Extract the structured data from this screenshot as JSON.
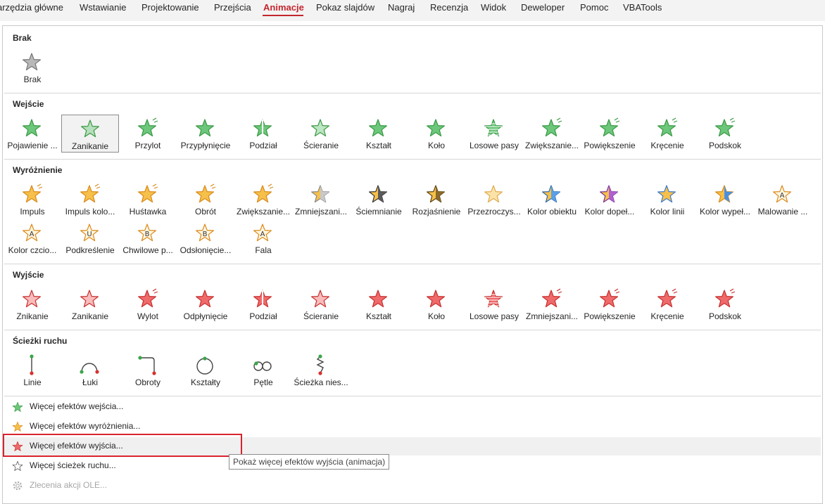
{
  "ribbon": {
    "tabs": [
      "arzędzia główne",
      "Wstawianie",
      "Projektowanie",
      "Przejścia",
      "Animacje",
      "Pokaz slajdów",
      "Nagraj",
      "Recenzja",
      "Widok",
      "Deweloper",
      "Pomoc",
      "VBATools"
    ],
    "active_tab": "Animacje"
  },
  "sections": {
    "none": {
      "title": "Brak",
      "items": [
        {
          "label": "Brak",
          "icon": "star-gray-icon"
        }
      ]
    },
    "entrance": {
      "title": "Wejście",
      "items": [
        {
          "label": "Pojawienie ...",
          "icon": "star-green-icon"
        },
        {
          "label": "Zanikanie",
          "icon": "star-green-fade-icon"
        },
        {
          "label": "Przylot",
          "icon": "star-green-fly-in-icon"
        },
        {
          "label": "Przypłynięcie",
          "icon": "star-green-float-in-icon"
        },
        {
          "label": "Podział",
          "icon": "star-green-split-icon"
        },
        {
          "label": "Ścieranie",
          "icon": "star-green-wipe-icon"
        },
        {
          "label": "Kształt",
          "icon": "star-green-shape-icon"
        },
        {
          "label": "Koło",
          "icon": "star-green-wheel-icon"
        },
        {
          "label": "Losowe pasy",
          "icon": "star-green-random-bars-icon"
        },
        {
          "label": "Zwiększanie...",
          "icon": "star-green-grow-turn-icon"
        },
        {
          "label": "Powiększenie",
          "icon": "star-green-zoom-icon"
        },
        {
          "label": "Kręcenie",
          "icon": "star-green-swivel-icon"
        },
        {
          "label": "Podskok",
          "icon": "star-green-bounce-icon"
        }
      ]
    },
    "emphasis": {
      "title": "Wyróżnienie",
      "items": [
        {
          "label": "Impuls",
          "icon": "star-orange-pulse-icon"
        },
        {
          "label": "Impuls kolo...",
          "icon": "star-orange-color-pulse-icon"
        },
        {
          "label": "Huśtawka",
          "icon": "star-orange-teeter-icon"
        },
        {
          "label": "Obrót",
          "icon": "star-orange-spin-icon"
        },
        {
          "label": "Zwiększanie...",
          "icon": "star-orange-grow-shrink-icon"
        },
        {
          "label": "Zmniejszani...",
          "icon": "star-gray-desaturate-icon"
        },
        {
          "label": "Ściemnianie",
          "icon": "star-dark-darken-icon"
        },
        {
          "label": "Rozjaśnienie",
          "icon": "star-brown-lighten-icon"
        },
        {
          "label": "Przezroczys...",
          "icon": "star-transparency-icon"
        },
        {
          "label": "Kolor obiektu",
          "icon": "star-object-color-icon"
        },
        {
          "label": "Kolor dopeł...",
          "icon": "star-complementary-color-icon"
        },
        {
          "label": "Kolor linii",
          "icon": "star-line-color-icon"
        },
        {
          "label": "Kolor wypeł...",
          "icon": "star-fill-color-icon"
        },
        {
          "label": "Malowanie ...",
          "icon": "star-brush-color-icon"
        },
        {
          "label": "Kolor czcio...",
          "icon": "star-font-color-icon"
        },
        {
          "label": "Podkreślenie",
          "icon": "star-underline-icon"
        },
        {
          "label": "Chwilowe p...",
          "icon": "star-bold-flash-icon"
        },
        {
          "label": "Odsłonięcie...",
          "icon": "star-bold-reveal-icon"
        },
        {
          "label": "Fala",
          "icon": "star-wave-icon"
        }
      ]
    },
    "exit": {
      "title": "Wyjście",
      "items": [
        {
          "label": "Znikanie",
          "icon": "star-red-disappear-icon"
        },
        {
          "label": "Zanikanie",
          "icon": "star-red-fade-icon"
        },
        {
          "label": "Wylot",
          "icon": "star-red-fly-out-icon"
        },
        {
          "label": "Odpłynięcie",
          "icon": "star-red-float-out-icon"
        },
        {
          "label": "Podział",
          "icon": "star-red-split-icon"
        },
        {
          "label": "Ścieranie",
          "icon": "star-red-wipe-icon"
        },
        {
          "label": "Kształt",
          "icon": "star-red-shape-icon"
        },
        {
          "label": "Koło",
          "icon": "star-red-wheel-icon"
        },
        {
          "label": "Losowe pasy",
          "icon": "star-red-random-bars-icon"
        },
        {
          "label": "Zmniejszani...",
          "icon": "star-red-shrink-turn-icon"
        },
        {
          "label": "Powiększenie",
          "icon": "star-red-zoom-icon"
        },
        {
          "label": "Kręcenie",
          "icon": "star-red-swivel-icon"
        },
        {
          "label": "Podskok",
          "icon": "star-red-bounce-icon"
        }
      ]
    },
    "motion": {
      "title": "Ścieżki ruchu",
      "items": [
        {
          "label": "Linie",
          "icon": "motion-line-icon"
        },
        {
          "label": "Łuki",
          "icon": "motion-arc-icon"
        },
        {
          "label": "Obroty",
          "icon": "motion-turn-icon"
        },
        {
          "label": "Kształty",
          "icon": "motion-shape-icon"
        },
        {
          "label": "Pętle",
          "icon": "motion-loop-icon"
        },
        {
          "label": "Ścieżka nies...",
          "icon": "motion-custom-path-icon"
        }
      ]
    }
  },
  "commands": [
    {
      "label": "Więcej efektów wejścia...",
      "icon": "star-green-icon",
      "enabled": true
    },
    {
      "label": "Więcej efektów wyróżnienia...",
      "icon": "star-orange-icon",
      "enabled": true
    },
    {
      "label": "Więcej efektów wyjścia...",
      "icon": "star-red-icon",
      "enabled": true
    },
    {
      "label": "Więcej ścieżek ruchu...",
      "icon": "star-outline-icon",
      "enabled": true
    },
    {
      "label": "Zlecenia akcji OLE...",
      "icon": "gear-icon",
      "enabled": false
    }
  ],
  "tooltip": "Pokaż więcej efektów wyjścia (animacja)",
  "colors": {
    "accent": "#c4262e",
    "highlight_box": "#d9232e",
    "entrance": "#4fb45a",
    "emphasis": "#f0a030",
    "exit": "#e04848"
  }
}
